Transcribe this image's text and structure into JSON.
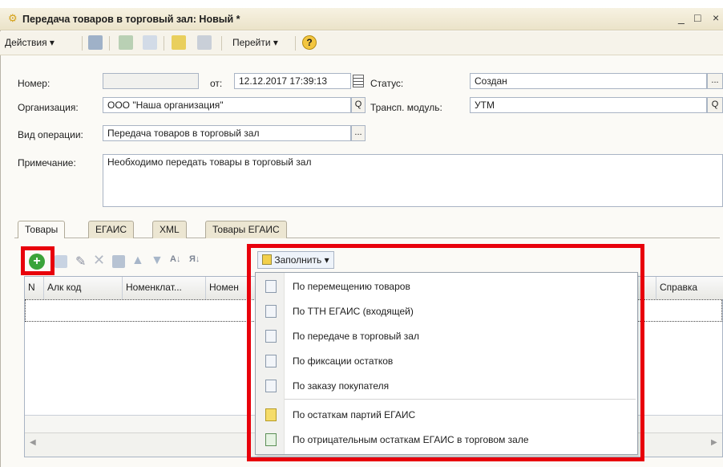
{
  "window": {
    "title": "Передача товаров в торговый зал: Новый *",
    "minimize": "_",
    "maximize": "□",
    "close": "×"
  },
  "toolbar": {
    "actions_label": "Действия",
    "goto_label": "Перейти",
    "help_label": "?"
  },
  "form": {
    "number_label": "Номер:",
    "number_value": "",
    "from_label": "от:",
    "date_value": "12.12.2017 17:39:13",
    "status_label": "Статус:",
    "status_value": "Создан",
    "org_label": "Организация:",
    "org_value": "ООО \"Наша организация\"",
    "transport_label": "Трансп. модуль:",
    "transport_value": "УТМ",
    "op_label": "Вид операции:",
    "op_value": "Передача товаров в торговый зал",
    "note_label": "Примечание:",
    "note_value": "Необходимо передать товары в торговый зал",
    "ellipsis": "...",
    "search_glyph": "Q"
  },
  "tabs": [
    {
      "label": "Товары"
    },
    {
      "label": "ЕГАИС"
    },
    {
      "label": "XML"
    },
    {
      "label": "Товары ЕГАИС"
    }
  ],
  "table_toolbar": {
    "fill_label": "Заполнить"
  },
  "table": {
    "columns": [
      "N",
      "Алк код",
      "Номенклат...",
      "Номен",
      "Справка"
    ]
  },
  "fill_menu": {
    "items": [
      {
        "label": "По перемещению товаров"
      },
      {
        "label": "По ТТН ЕГАИС (входящей)"
      },
      {
        "label": "По передаче в торговый зал"
      },
      {
        "label": "По фиксации остатков"
      },
      {
        "label": "По заказу покупателя"
      },
      {
        "label": "По остаткам партий ЕГАИС"
      },
      {
        "label": "По отрицательным остаткам ЕГАИС в торговом зале"
      }
    ]
  },
  "colors": {
    "highlight": "#e8000b",
    "add_icon": "#3aa33a"
  }
}
